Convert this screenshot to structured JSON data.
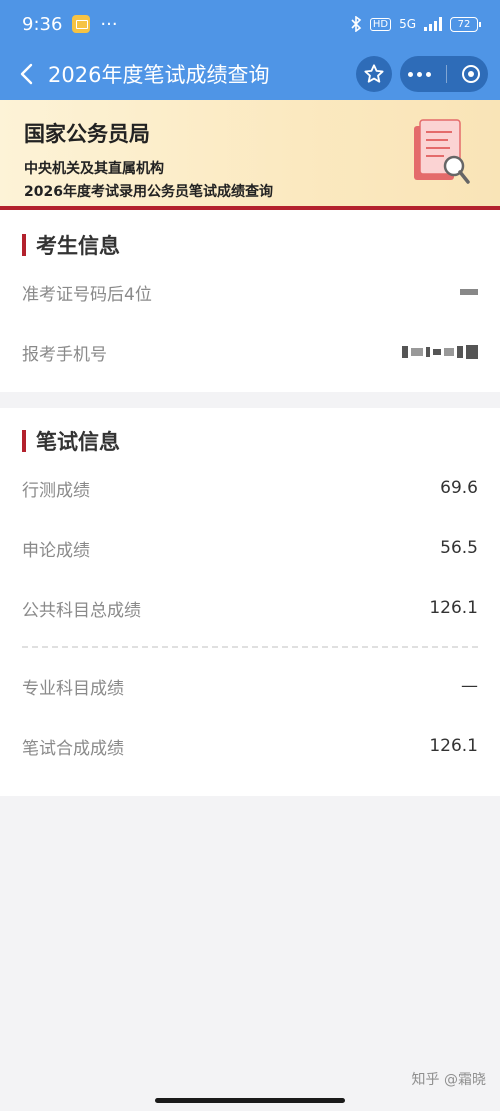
{
  "status_bar": {
    "time": "9:36",
    "more": "···",
    "hd": "HD",
    "network": "5G",
    "battery": "72"
  },
  "nav": {
    "title": "2026年度笔试成绩查询"
  },
  "banner": {
    "org": "国家公务员局",
    "line1": "中央机关及其直属机构",
    "line2": "2026年度考试录用公务员笔试成绩查询"
  },
  "candidate": {
    "title": "考生信息",
    "rows": [
      {
        "label": "准考证号码后4位"
      },
      {
        "label": "报考手机号"
      }
    ]
  },
  "exam": {
    "title": "笔试信息",
    "rows": [
      {
        "label": "行测成绩",
        "value": "69.6"
      },
      {
        "label": "申论成绩",
        "value": "56.5"
      },
      {
        "label": "公共科目总成绩",
        "value": "126.1"
      },
      {
        "label": "专业科目成绩",
        "value": "—"
      },
      {
        "label": "笔试合成成绩",
        "value": "126.1"
      }
    ]
  },
  "watermark": "知乎 @霜晓",
  "colors": {
    "header_blue": "#4f95e6",
    "accent_red": "#b3212d",
    "banner_bg": "#fbe9c0"
  }
}
